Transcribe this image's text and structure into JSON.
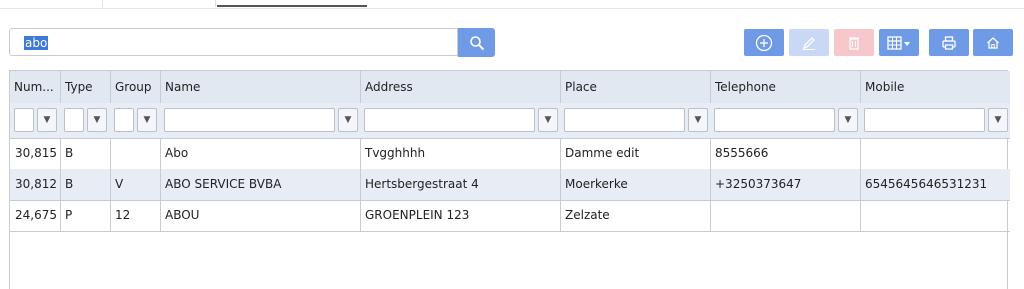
{
  "search": {
    "value": "abo"
  },
  "columns": [
    "Num...",
    "Type",
    "Group",
    "Name",
    "Address",
    "Place",
    "Telephone",
    "Mobile"
  ],
  "rows": [
    [
      "30,815",
      "B",
      "",
      "Abo",
      "Tvgghhhh",
      "Damme edit",
      "8555666",
      ""
    ],
    [
      "30,812",
      "B",
      "V",
      "ABO SERVICE BVBA",
      "Hertsbergestraat 4",
      "Moerkerke",
      "+3250373647",
      "6545645646531231"
    ],
    [
      "24,675",
      "P",
      "12",
      "ABOU",
      "GROENPLEIN 123",
      "Zelzate",
      "",
      ""
    ]
  ],
  "colors": {
    "accent": "#6f9be6",
    "header_bg": "#e2e8f2",
    "alt_row": "#e8edf5",
    "disabled_edit": "#c9d9f5",
    "disabled_delete": "#f7c8cb"
  },
  "icons": {
    "search": "search-icon",
    "add": "plus-circle-icon",
    "edit": "pencil-icon",
    "delete": "trash-icon",
    "columns": "columns-icon",
    "print": "print-icon",
    "home": "home-icon"
  }
}
